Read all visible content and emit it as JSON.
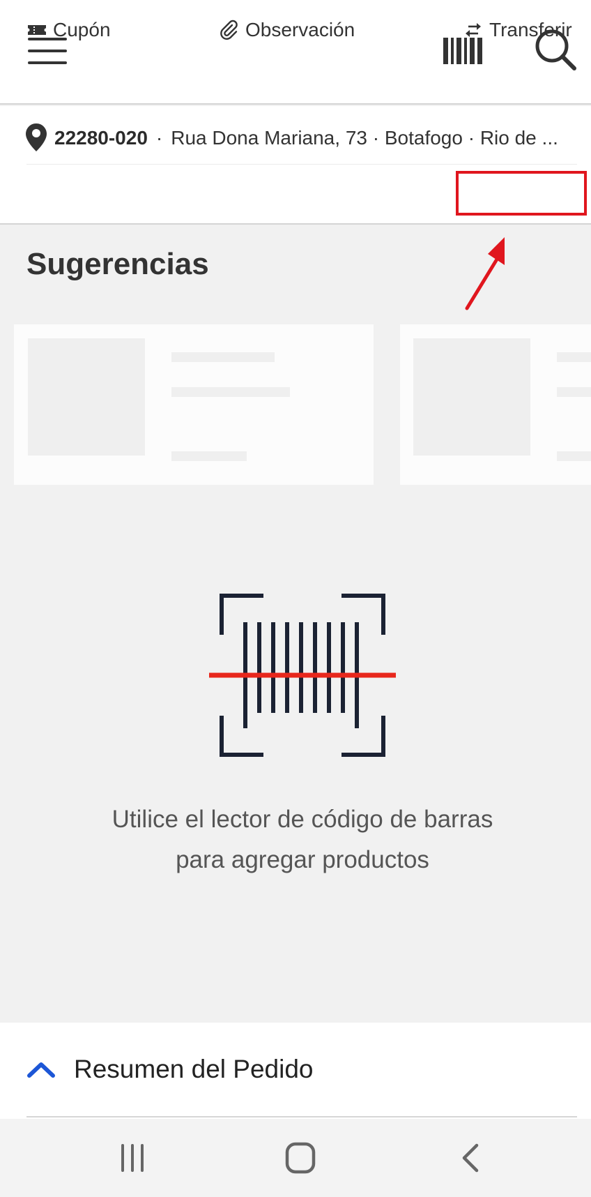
{
  "header": {
    "menu_icon": "hamburger-menu-icon",
    "barcode_icon": "barcode-icon",
    "search_icon": "search-icon"
  },
  "address": {
    "icon": "map-pin-icon",
    "cep": "22280-020",
    "separator": "·",
    "street": "Rua Dona Mariana, 73 · Botafogo · Rio de ..."
  },
  "actions": {
    "cupon": {
      "label": "Cupón",
      "icon": "ticket-icon"
    },
    "observacion": {
      "label": "Observación",
      "icon": "paperclip-icon"
    },
    "transferir": {
      "label": "Transferir",
      "icon": "swap-arrows-icon"
    }
  },
  "suggestions": {
    "title": "Sugerencias"
  },
  "empty_state": {
    "icon": "barcode-scanner-icon",
    "line1": "Utilice el lector de código de barras",
    "line2": "para agregar productos"
  },
  "order_summary": {
    "label": "Resumen del Pedido",
    "icon": "chevron-up-icon"
  },
  "system_nav": {
    "recents_icon": "recents-icon",
    "home_icon": "home-icon",
    "back_icon": "back-icon"
  },
  "colors": {
    "highlight": "#e0161e",
    "accent": "#1c56d6",
    "scan_line": "#e8271c",
    "icon_dark": "#1b2233"
  }
}
